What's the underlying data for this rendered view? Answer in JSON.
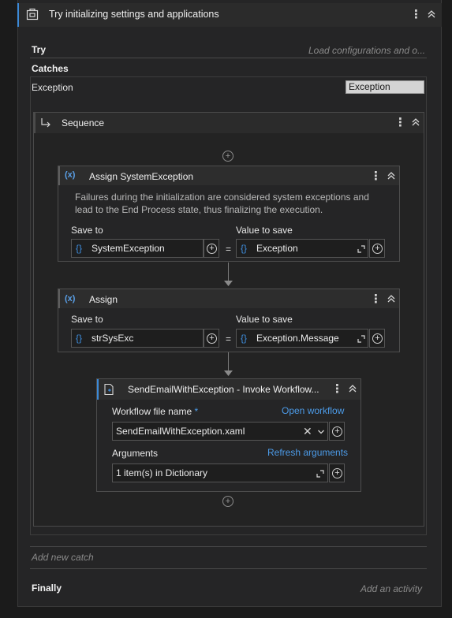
{
  "try_catch": {
    "title": "Try initializing settings and applications",
    "try_label": "Try",
    "try_placeholder": "Load configurations and o...",
    "catches_label": "Catches",
    "exception_label": "Exception",
    "exception_type": "Exception",
    "add_catch": "Add new catch",
    "finally_label": "Finally",
    "finally_placeholder": "Add an activity"
  },
  "sequence": {
    "title": "Sequence"
  },
  "assign1": {
    "title": "Assign SystemException",
    "description": "Failures during the initialization are considered system exceptions and lead to the End Process state, thus finalizing the execution.",
    "save_to_label": "Save to",
    "value_label": "Value to save",
    "save_to_value": "SystemException",
    "value_value": "Exception",
    "equals": "="
  },
  "assign2": {
    "title": "Assign",
    "save_to_label": "Save to",
    "value_label": "Value to save",
    "save_to_value": "strSysExc",
    "value_value": "Exception.Message",
    "equals": "="
  },
  "invoke": {
    "title": "SendEmailWithException - Invoke Workflow...",
    "file_label": "Workflow file name",
    "required_mark": "*",
    "open_link": "Open workflow",
    "file_value": "SendEmailWithException.xaml",
    "args_label": "Arguments",
    "refresh_link": "Refresh arguments",
    "args_value": "1 item(s) in Dictionary"
  },
  "icons": {
    "brace": "{}",
    "assign": "(x)",
    "plus": "+",
    "kebab": "⋮",
    "clear": "✕",
    "dropdown": "⌄"
  },
  "colors": {
    "accent": "#3c8ad8",
    "link": "#4c9be8",
    "background": "#1b1b1b"
  }
}
